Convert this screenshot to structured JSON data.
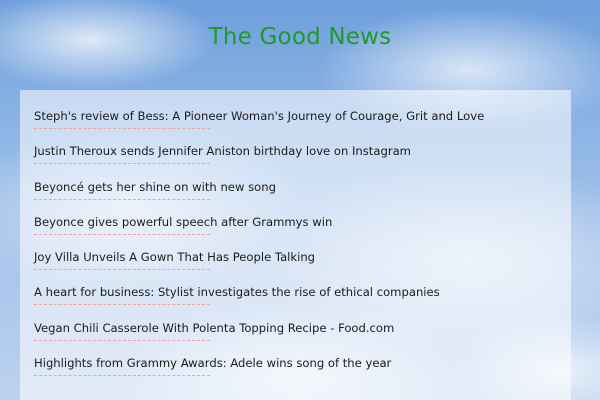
{
  "page": {
    "title": "The Good News",
    "title_color": "#1e9a2a"
  },
  "news": {
    "items": [
      {
        "label": "Steph's review of Bess: A Pioneer Woman's Journey of Courage, Grit and Love"
      },
      {
        "label": "Justin Theroux sends Jennifer Aniston birthday love on Instagram"
      },
      {
        "label": "Beyoncé gets her shine on with new song"
      },
      {
        "label": "Beyonce gives powerful speech after Grammys win"
      },
      {
        "label": "Joy Villa Unveils A Gown That Has People Talking"
      },
      {
        "label": "A heart for business: Stylist investigates the rise of ethical companies"
      },
      {
        "label": "Vegan Chili Casserole With Polenta Topping Recipe - Food.com"
      },
      {
        "label": "Highlights from Grammy Awards: Adele wins song of the year"
      }
    ]
  }
}
